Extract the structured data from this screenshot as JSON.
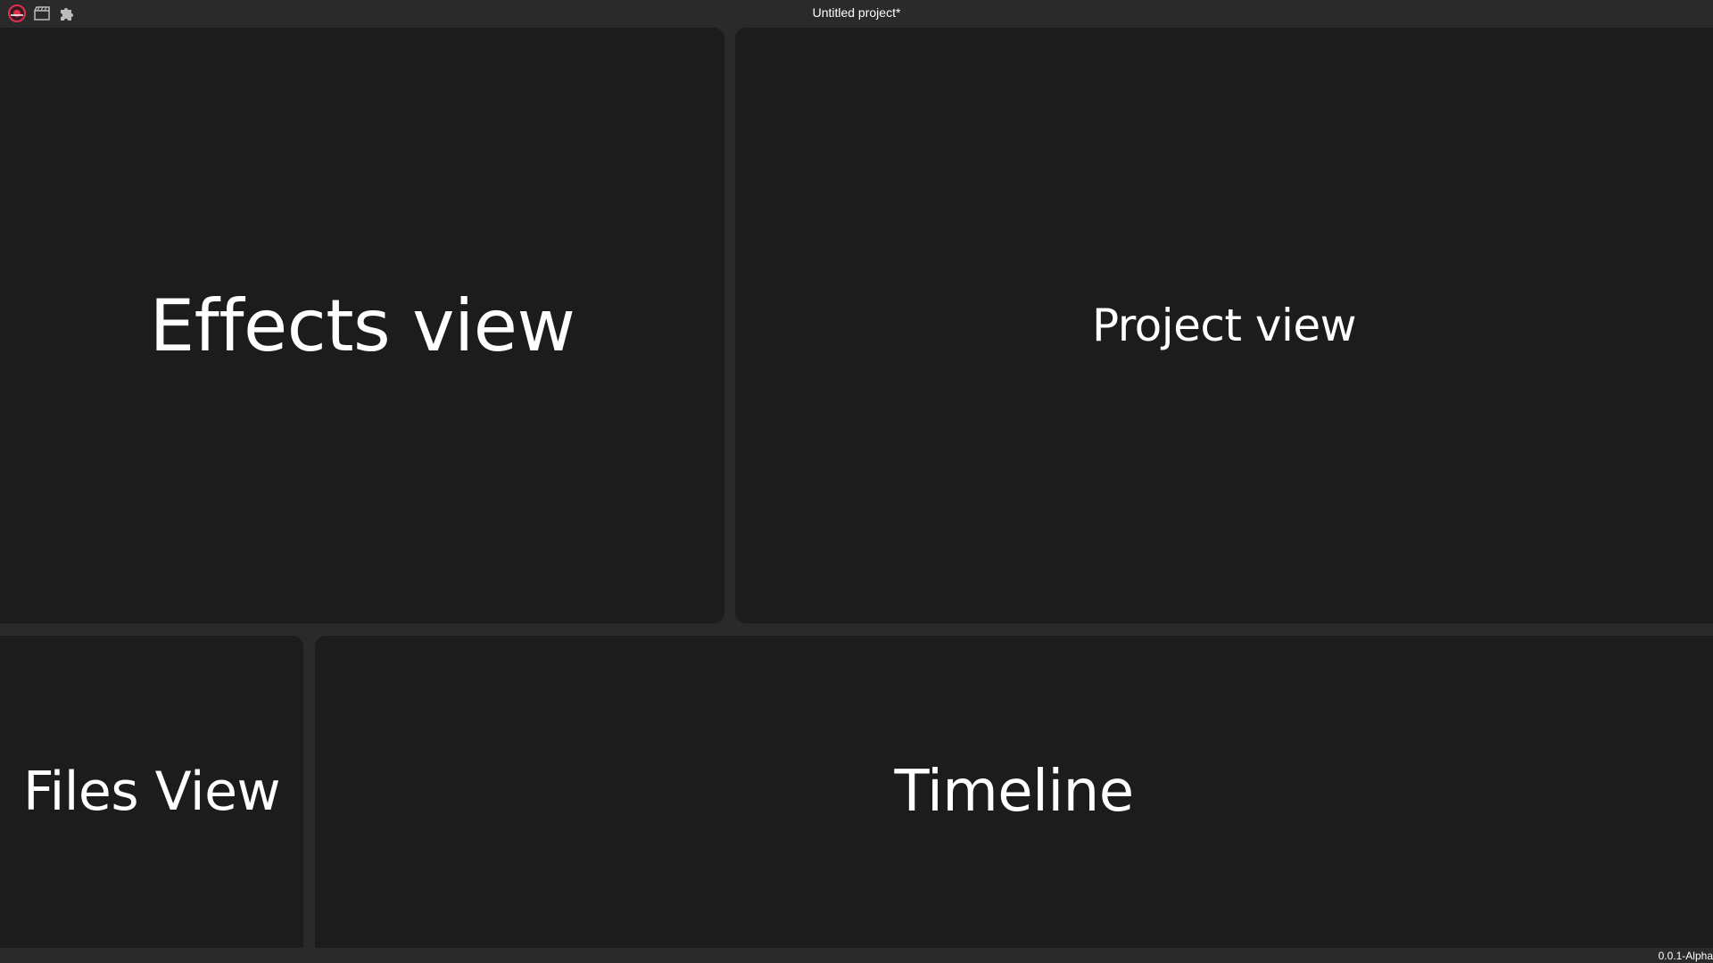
{
  "window": {
    "title": "Untitled project*"
  },
  "toolbar": {
    "icons": [
      "app-logo-icon",
      "clapperboard-icon",
      "puzzle-icon"
    ]
  },
  "panels": {
    "effects": {
      "label": "Effects view"
    },
    "project": {
      "label": "Project view"
    },
    "files": {
      "label": "Files View"
    },
    "timeline": {
      "label": "Timeline"
    }
  },
  "status": {
    "version": "0.0.1-Alpha"
  },
  "colors": {
    "background": "#2a2a2a",
    "panel": "#1c1c1c",
    "text": "#ffffff",
    "logo_accent": "#e0304a"
  }
}
